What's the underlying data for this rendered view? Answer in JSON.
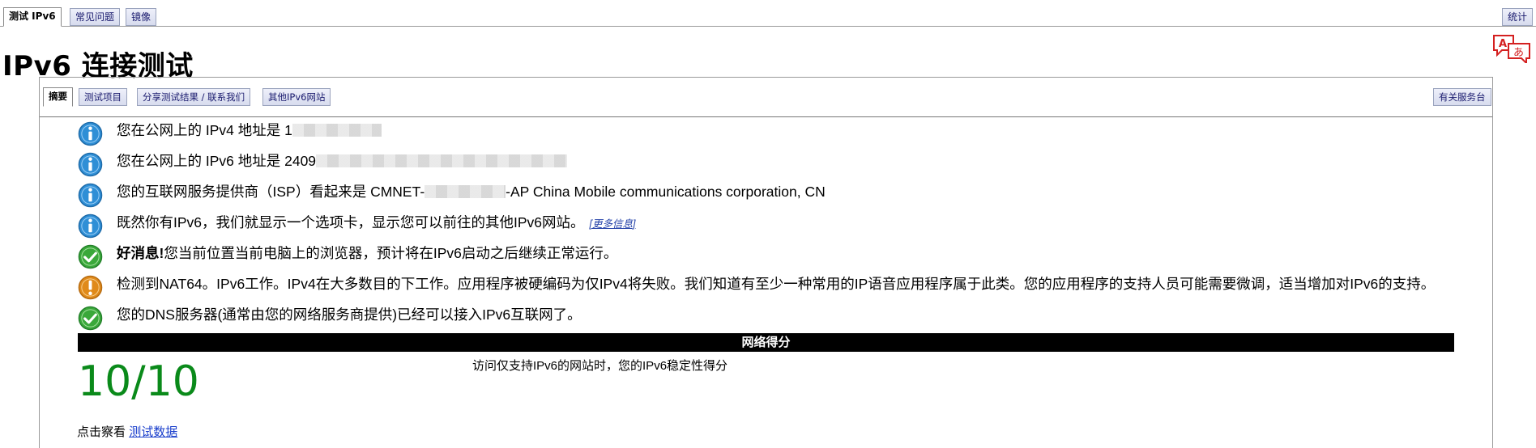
{
  "top_tabs": {
    "tab_test": "测试 IPv6",
    "tab_faq": "常见问题",
    "tab_mirror": "镜像",
    "tab_stats": "统计"
  },
  "page_title": "IPv6 连接测试",
  "inner_tabs": {
    "summary": "摘要",
    "tests": "测试项目",
    "share": "分享测试结果 / 联系我们",
    "other_sites": "其他IPv6网站",
    "about_service": "有关服务台"
  },
  "summary": {
    "ipv4_prefix": "您在公网上的 IPv4 地址是 1",
    "ipv6_prefix": "您在公网上的 IPv6 地址是 2409",
    "isp_prefix": "您的互联网服务提供商（ISP）看起来是 CMNET-",
    "isp_suffix": "-AP China Mobile communications corporation, CN",
    "tab_notice": "既然你有IPv6，我们就显示一个选项卡，显示您可以前往的其他IPv6网站。",
    "more_info": "[更多信息]",
    "good_news_bold": "好消息!",
    "good_news_text": "您当前位置当前电脑上的浏览器，预计将在IPv6启动之后继续正常运行。",
    "nat64_text": "检测到NAT64。IPv6工作。IPv4在大多数目的下工作。应用程序被硬编码为仅IPv4将失败。我们知道有至少一种常用的IP语音应用程序属于此类。您的应用程序的支持人员可能需要微调，适当增加对IPv6的支持。",
    "dns_text": "您的DNS服务器(通常由您的网络服务商提供)已经可以接入IPv6互联网了。"
  },
  "score": {
    "header": "网络得分",
    "value": "10/10",
    "description": "访问仅支持IPv6的网站时，您的IPv6稳定性得分"
  },
  "footer": {
    "prefix": "点击察看",
    "link": "测试数据"
  },
  "icons": {
    "info": "info-icon",
    "check": "check-icon",
    "warning": "warning-icon",
    "translate": "translate-icon"
  },
  "colors": {
    "info_blue": "#2f8fd6",
    "ok_green": "#3aa83a",
    "warn_orange": "#e08a1a",
    "score_green": "#0a8a1a",
    "link_blue": "#1a3fcc"
  }
}
